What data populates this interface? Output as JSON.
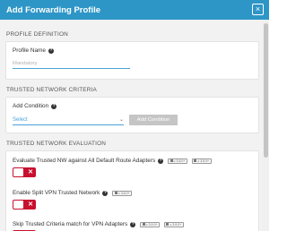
{
  "header": {
    "title": "Add Forwarding Profile",
    "close_glyph": "×"
  },
  "sections": {
    "profile_definition": "PROFILE DEFINITION",
    "trusted_network_criteria": "TRUSTED NETWORK CRITERIA",
    "trusted_network_evaluation": "TRUSTED NETWORK EVALUATION"
  },
  "profile": {
    "name_label": "Profile Name",
    "name_placeholder": "Mandatory",
    "name_value": ""
  },
  "criteria": {
    "add_condition_label": "Add Condition",
    "select_value": "Select",
    "add_button": "Add Condition"
  },
  "evaluation": {
    "rows": [
      {
        "label": "Evaluate Trusted NW against All Default Route Adapters",
        "badges": [
          "≥ 3.6.0+",
          "≥ 3.6.0+"
        ],
        "enabled": false
      },
      {
        "label": "Enable Split VPN Trusted Network",
        "badges": [
          "≥ 3.6.0+"
        ],
        "enabled": false
      },
      {
        "label": "Skip Trusted Criteria match for VPN Adapters",
        "badges": [
          "≥ 3.9.0+",
          "≥ 3.9.0+"
        ],
        "enabled": false
      }
    ]
  },
  "icons": {
    "help": "question-circle-icon",
    "close": "close-icon",
    "chevron": "chevron-down-icon",
    "toggle_off": "x-icon"
  },
  "colors": {
    "header": "#2e96c7",
    "accent": "#4aa3d8",
    "toggle_off": "#c8102e",
    "button_disabled": "#c5c5c5"
  }
}
